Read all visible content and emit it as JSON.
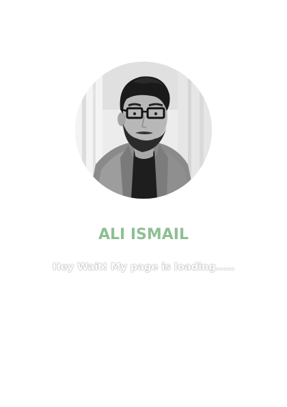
{
  "profile": {
    "avatar_icon": "portrait-photo",
    "name": "ALI ISMAIL",
    "loading_message": "Hey Wait! My page is loading....."
  },
  "colors": {
    "background": "#ffffff",
    "name_accent": "#8ebf93",
    "loading_outline": "#9c9c9c"
  }
}
